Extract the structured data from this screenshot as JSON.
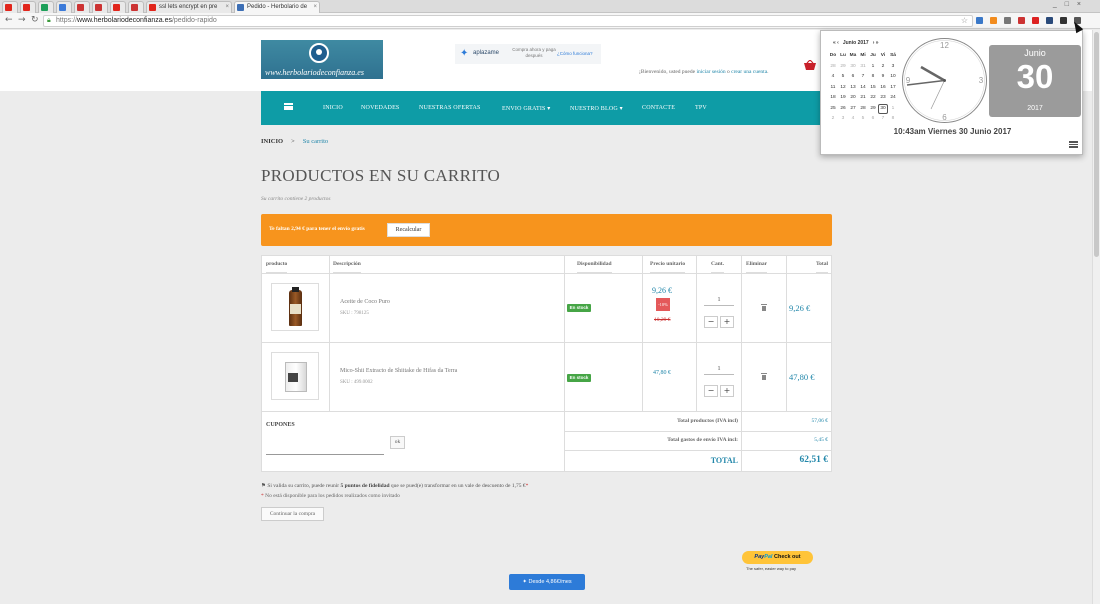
{
  "browser": {
    "tabs": [
      {
        "label": "",
        "color": "#e1251b"
      },
      {
        "label": "",
        "color": "#e1251b"
      },
      {
        "label": "",
        "color": "#1ea05a"
      },
      {
        "label": "",
        "color": "#3d7bd9"
      },
      {
        "label": "",
        "color": "#c33"
      },
      {
        "label": "",
        "color": "#c33"
      },
      {
        "label": "",
        "color": "#e1251b"
      },
      {
        "label": "",
        "color": "#c33"
      },
      {
        "label": "ssl lets encrypt en pre",
        "color": "#e1251b"
      },
      {
        "label": "Pedido - Herbolario de",
        "color": "#3d6fb5"
      }
    ],
    "url_scheme": "https://",
    "url_host": "www.herbolariodeconfianza.es",
    "url_path": "/pedido-rapido",
    "window_controls": "_ □ ×"
  },
  "header": {
    "logo_text": "www.herbolariodeconfianza.es",
    "aplazame_name": "aplazame",
    "aplazame_desc": "Compra ahora y paga después",
    "aplazame_link": "¿Cómo funciona?",
    "welcome_prefix": "¡Bienvenido, usted puede ",
    "login_link": "iniciar sesión",
    "welcome_mid": " o ",
    "register_link": "crear una cuenta",
    "welcome_suffix": "."
  },
  "nav": {
    "items": [
      "INICIO",
      "NOVEDADES",
      "NUESTRAS OFERTAS",
      "ENVIO GRATIS ▾",
      "NUESTRO BLOG ▾",
      "CONTACTE",
      "TPV"
    ]
  },
  "breadcrumb": {
    "home": "INICIO",
    "sep": ">",
    "current": "Su carrito"
  },
  "page_title": "PRODUCTOS EN SU CARRITO",
  "cart_count": "Su carrito contiene 2 productos",
  "shipping_banner": {
    "message": "Te faltan 2,94 € para tener el envío gratis",
    "button": "Recalcular",
    "color": "#f7941d"
  },
  "table": {
    "headers": [
      "producto",
      "Descripción",
      "Disponibilidad",
      "Precio unitario",
      "Cant.",
      "Eliminar",
      "Total"
    ],
    "rows": [
      {
        "name": "Aceite de Coco Puro",
        "sku": "SKU : 798125",
        "availability": "En stock",
        "price": "9,26 €",
        "discount": "-10%",
        "old_price": "10,29 €",
        "qty": "1",
        "total": "9,26 €"
      },
      {
        "name": "Mico-Shii Extracto de Shiitake de Hifas da Terra",
        "sku": "SKU : 499.0002",
        "availability": "En stock",
        "price": "47,80 €",
        "qty": "1",
        "total": "47,80 €"
      }
    ],
    "coupons_label": "CUPONES",
    "coupon_button": "ok",
    "total_products_label": "Total productos (IVA incl)",
    "total_products": "57,06 €",
    "shipping_label": "Total gastos de envío IVA incl:",
    "shipping": "5,45 €",
    "total_label": "TOTAL",
    "total": "62,51 €"
  },
  "loyalty": {
    "prefix": "Si valida su carrito, puede reunir ",
    "points": "5 puntos de fidelidad",
    "suffix": " que se pued(e) transformar en un vale de descuento de 1,75 €",
    "star": "*"
  },
  "invite_note": "No está disponible para los pedidos realizados como invitado",
  "continue_button": "Continuar la compra",
  "paypal": {
    "brand1": "Pay",
    "brand2": "Pal",
    "action": "Check out",
    "tagline": "The safer, easier way to pay"
  },
  "aplazame_button": "Desde 4,86€/mes",
  "clock_popup": {
    "month_label": "Junio 2017",
    "prev": "«  ‹",
    "next": "›  »",
    "weekdays": [
      "Do",
      "Lu",
      "Ma",
      "Mi",
      "Ju",
      "Vi",
      "Sá"
    ],
    "weeks": [
      [
        "28",
        "29",
        "30",
        "31",
        "1",
        "2",
        "3"
      ],
      [
        "4",
        "5",
        "6",
        "7",
        "8",
        "9",
        "10"
      ],
      [
        "11",
        "12",
        "13",
        "14",
        "15",
        "16",
        "17"
      ],
      [
        "18",
        "19",
        "20",
        "21",
        "22",
        "23",
        "24"
      ],
      [
        "25",
        "26",
        "27",
        "28",
        "29",
        "30",
        "1"
      ],
      [
        "2",
        "3",
        "4",
        "5",
        "6",
        "7",
        "8"
      ]
    ],
    "today": "30",
    "clock_numbers": [
      "12",
      "3",
      "6",
      "9"
    ],
    "card_month": "Junio",
    "card_day": "30",
    "card_year": "2017",
    "time_line": "10:43am Viernes 30 Junio 2017",
    "card_color": "#9b9b9b"
  }
}
